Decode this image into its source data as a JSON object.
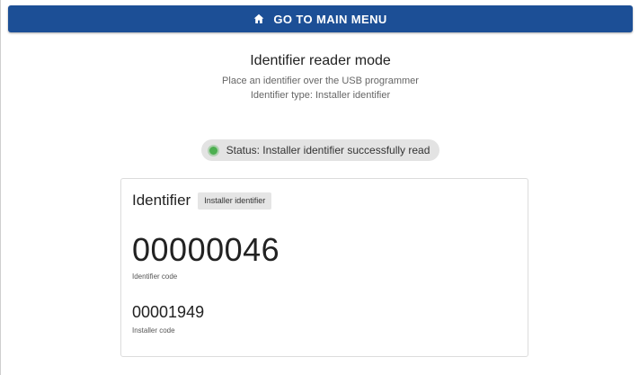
{
  "top_button": {
    "label": "GO TO MAIN MENU",
    "icon": "home-icon",
    "color": "#1c4f96"
  },
  "header": {
    "title": "Identifier reader mode",
    "instruction": "Place an identifier over the USB programmer",
    "identifier_type": "Identifier type: Installer identifier"
  },
  "status": {
    "text": "Status: Installer identifier successfully read",
    "indicator_color": "#4caf50"
  },
  "card": {
    "title": "Identifier",
    "badge": "Installer identifier",
    "identifier_code": "00000046",
    "identifier_code_label": "Identifier code",
    "installer_code": "00001949",
    "installer_code_label": "Installer code"
  }
}
